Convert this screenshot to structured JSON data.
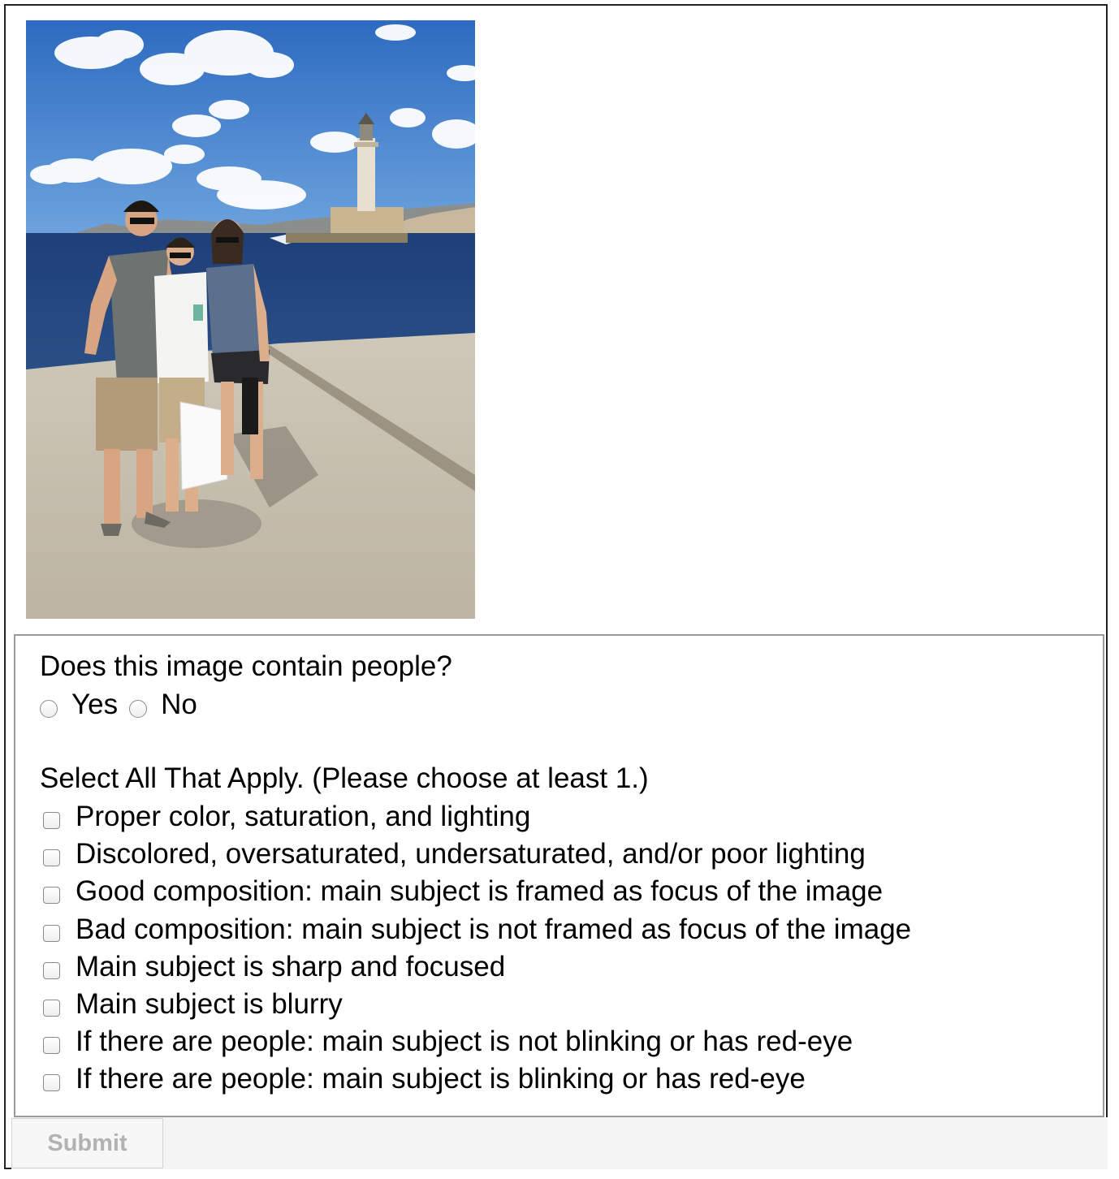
{
  "question": {
    "prompt": "Does this image contain people?",
    "options": [
      "Yes",
      "No"
    ]
  },
  "checklist": {
    "heading": "Select All That Apply. (Please choose at least 1.)",
    "items": [
      "Proper color, saturation, and lighting",
      "Discolored, oversaturated, undersaturated, and/or poor lighting",
      "Good composition: main subject is framed as focus of the image",
      "Bad composition: main subject is not framed as focus of the image",
      "Main subject is sharp and focused",
      "Main subject is blurry",
      "If there are people: main subject is not blinking or has red-eye",
      "If there are people: main subject is blinking or has red-eye"
    ]
  },
  "submit": {
    "label": "Submit"
  }
}
